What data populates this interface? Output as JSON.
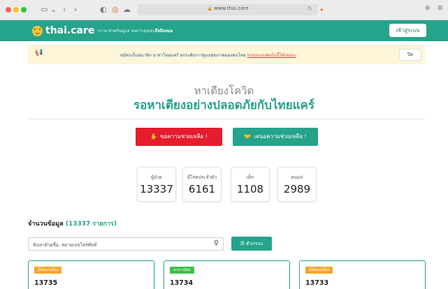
{
  "browser": {
    "url": "www.thai.care",
    "reload_icon": "reload-icon"
  },
  "header": {
    "logo_text": "thai.care",
    "tagline_prefix": "เราจะช่วยกันดูแล",
    "tagline_middle": " จนกว่าคุณจะ",
    "tagline_bold": "ถึงมือหมอ",
    "login_label": "เข้าสู่ระบบ"
  },
  "notice": {
    "text": "สมัครเป็นสมาชิก อาสาไทยแคร์ ยกระดับการดูแลสุขภาพของคนไทย ",
    "link": "กรอกแบบฟอร์มนี้ได้เลยนะ",
    "close_label": "ปิด"
  },
  "hero": {
    "title": "หาเตียงโควิด",
    "subtitle": "รอหาเตียงอย่างปลอดภัยกับไทยแคร์",
    "help_label": "ขอความช่วยเหลือ !",
    "offer_label": "เสนอความช่วยเหลือ !"
  },
  "stats": [
    {
      "label": "ผู้ป่วย",
      "value": "13337"
    },
    {
      "label": "มีโรคประจำตัว",
      "value": "6161"
    },
    {
      "label": "เด็ก",
      "value": "1108"
    },
    {
      "label": "คนแก่",
      "value": "2989"
    }
  ],
  "data_section": {
    "count_label": "จำนวนข้อมูล ",
    "count_value": "(13337 รายการ)",
    "search_placeholder": "ค้นหาด้วยชื่อ, หมายเลขโทรศัพท์",
    "filter_label": "ตัวกรอง"
  },
  "cards": [
    {
      "tag": "มีอัพเดทเตียง",
      "tag_color": "#f5a623",
      "id": "13735"
    },
    {
      "tag": "อาการน้อย",
      "tag_color": "#3fbf4a",
      "id": "13734"
    },
    {
      "tag": "มีอัพเดทเตียง",
      "tag_color": "#f5a623",
      "id": "13733"
    }
  ],
  "colors": {
    "brand": "#26a38b",
    "danger": "#e51c2d",
    "notice_bg": "#fdf6d8"
  }
}
